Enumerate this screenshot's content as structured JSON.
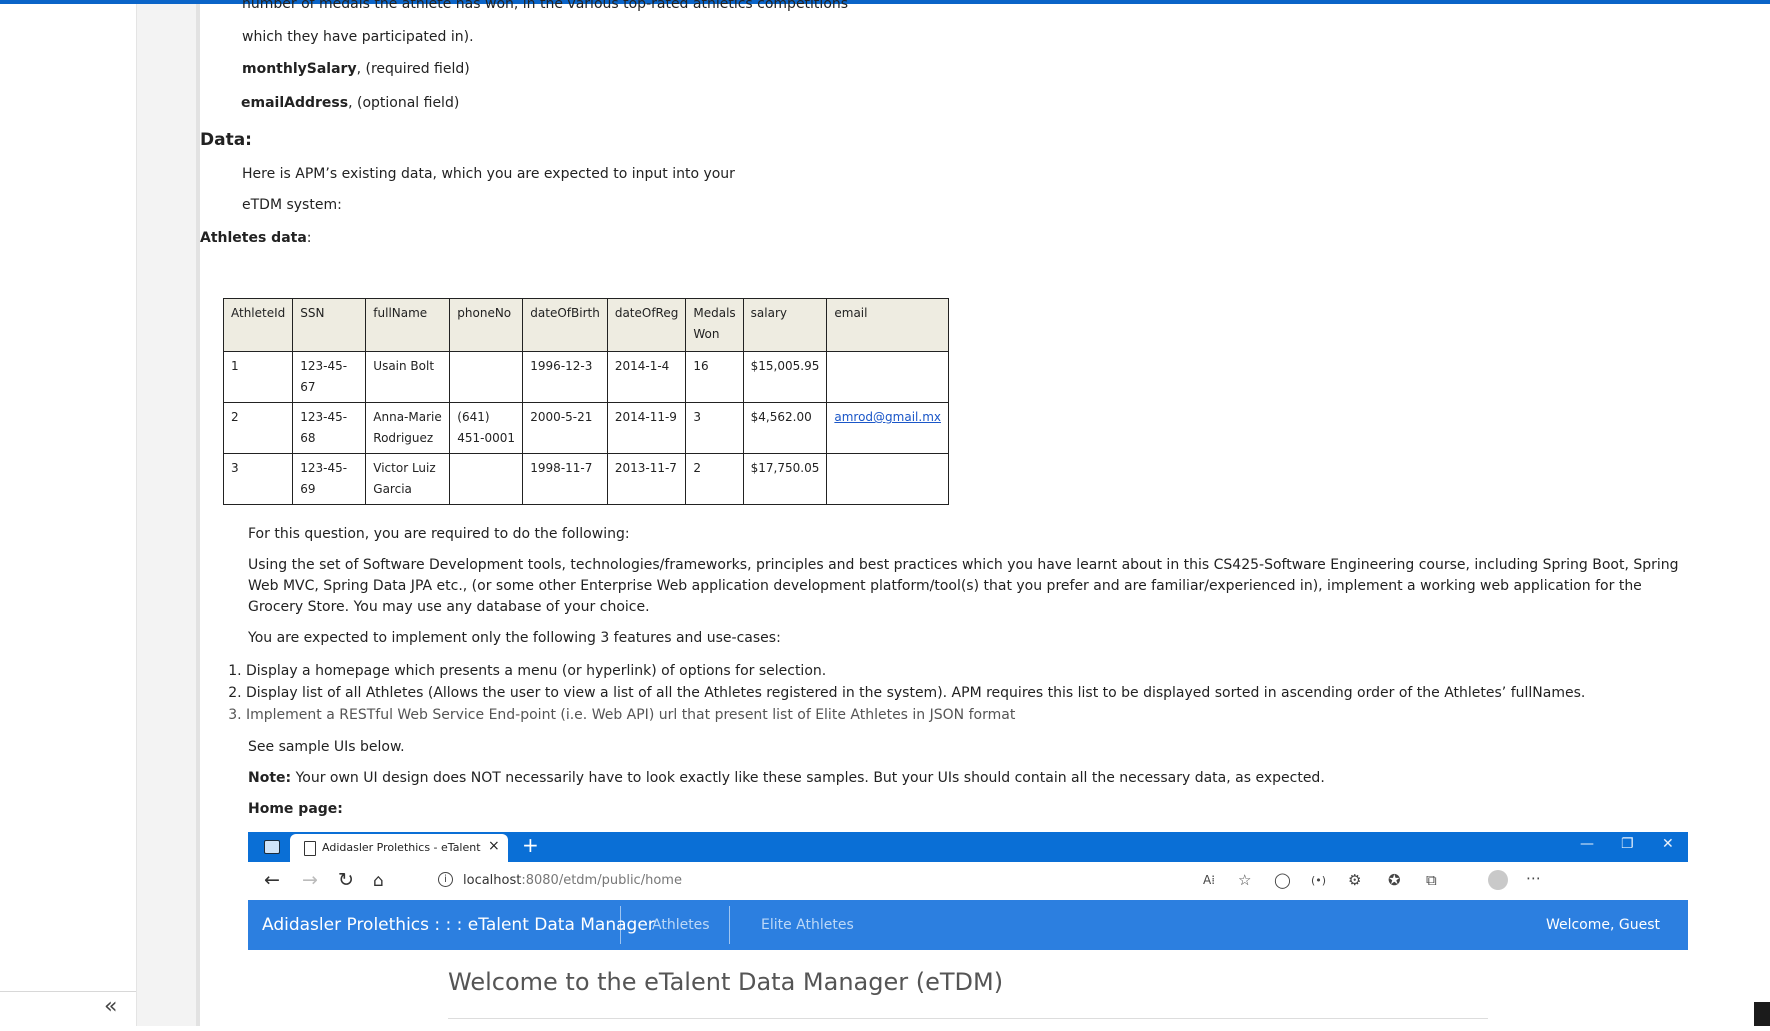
{
  "doc": {
    "line_medals_1": "number of medals the athlete has won, in the various top-rated athletics competitions",
    "line_medals_2": "which they have participated in).",
    "field_salary_name": "monthlySalary",
    "field_salary_note": ", (required field)",
    "field_email_name": "emailAddress",
    "field_email_note": ", (optional field)",
    "data_heading": "Data:",
    "data_intro_1": "Here is APM’s existing data, which you are expected to input into your",
    "data_intro_2": "eTDM system:",
    "athletes_heading": "Athletes data",
    "athletes_heading_colon": ":",
    "table": {
      "headers": [
        "AthleteId",
        "SSN",
        "fullName",
        "phoneNo",
        "dateOfBirth",
        "dateOfReg",
        "Medals Won",
        "salary",
        "email"
      ],
      "rows": [
        [
          "1",
          "123-45-67",
          "Usain Bolt",
          "",
          "1996-12-3",
          "2014-1-4",
          "16",
          "$15,005.95",
          ""
        ],
        [
          "2",
          "123-45-68",
          "Anna-Marie Rodriguez",
          "(641) 451-0001",
          "2000-5-21",
          "2014-11-9",
          "3",
          "$4,562.00",
          "amrod@gmail.mx"
        ],
        [
          "3",
          "123-45-69",
          "Victor Luiz Garcia",
          "",
          "1998-11-7",
          "2013-11-7",
          "2",
          "$17,750.05",
          ""
        ]
      ]
    },
    "q_intro": "For this question, you are required to do the following:",
    "q_body": "Using the set of Software Development tools, technologies/frameworks, principles and best practices which you have learnt about in this CS425-Software Engineering course, including Spring Boot, Spring Web MVC, Spring Data JPA etc., (or some other Enterprise Web application development platform/tool(s) that you prefer and are familiar/experienced in), implement a working web application for the Grocery Store. You may use any database of your choice.",
    "q_expect": "You are expected to implement only the following 3 features and use-cases:",
    "use_cases": [
      "Display a homepage which presents a menu (or hyperlink) of options for selection.",
      "Display list of all Athletes (Allows the user to view a list of all the Athletes registered in the system). APM requires this list to be displayed sorted in ascending order of the Athletes’ fullNames.",
      "Implement a RESTful Web Service End-point (i.e. Web API) url that present list of Elite Athletes in JSON format"
    ],
    "see_samples": "See sample UIs below.",
    "note_label": "Note:",
    "note_text": " Your own UI design does NOT necessarily have to look exactly like these samples. But your UIs should contain all the necessary data, as expected.",
    "home_page_label": "Home page:"
  },
  "screenshot": {
    "tab_title": "Adidasler Prolethics - eTalent Da",
    "tab_close": "×",
    "new_tab": "+",
    "url_host": "localhost",
    "url_path": ":8080/etdm/public/home",
    "brand": "Adidasler Prolethics : : : eTalent Data Manager",
    "nav_athletes": "Athletes",
    "nav_elite": "Elite Athletes",
    "welcome_user": "Welcome, Guest",
    "welcome_heading": "Welcome to the eTalent Data Manager (eTDM)"
  },
  "sidebar": {
    "collapse_glyph": "«"
  },
  "colors": {
    "accent_blue": "#0a6fd6",
    "app_nav": "#2c7fe0",
    "table_header": "#eeece1",
    "link": "#1a56c8"
  }
}
